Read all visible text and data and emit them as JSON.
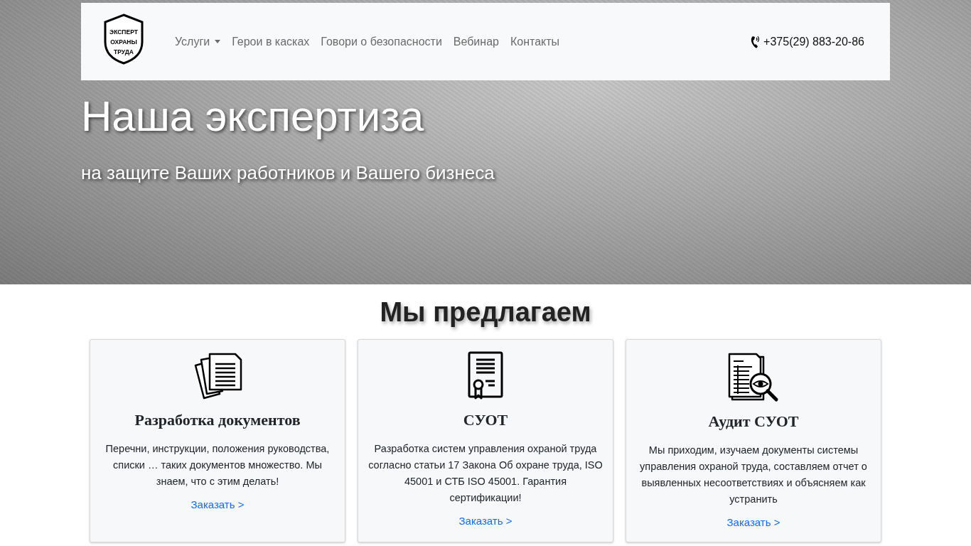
{
  "navbar": {
    "logo_lines": [
      "ЭКСПЕРТ",
      "ОХРАНЫ",
      "ТРУДА"
    ],
    "menu": [
      {
        "label": "Услуги",
        "dropdown": true
      },
      {
        "label": "Герои в касках",
        "dropdown": false
      },
      {
        "label": "Говори о безопасности",
        "dropdown": false
      },
      {
        "label": "Вебинар",
        "dropdown": false
      },
      {
        "label": "Контакты",
        "dropdown": false
      }
    ],
    "phone": "+375(29) 883-20-86"
  },
  "hero": {
    "title": "Наша экспертиза",
    "subtitle": "на защите Ваших работников и Вашего бизнеса"
  },
  "offers": {
    "title": "Мы предлагаем",
    "cards": [
      {
        "kind": "documents",
        "title": "Разработка документов",
        "text": "Перечни, инструкции, положения руководства, списки … таких документов множество. Мы знаем, что с этим делать!",
        "link": "Заказать >"
      },
      {
        "kind": "certificate",
        "title": "СУОТ",
        "text": "Разработка систем управления охраной труда согласно статьи 17 Закона Об охране труда, ISO 45001 и СТБ ISO 45001. Гарантия сертификации!",
        "link": "Заказать >"
      },
      {
        "kind": "audit",
        "title": "Аудит СУОТ",
        "text": "Мы приходим, изучаем документы системы управления охраной труда, составляем отчет о выявленных несоответствиях и объясняем как устранить",
        "link": "Заказать >"
      }
    ]
  }
}
